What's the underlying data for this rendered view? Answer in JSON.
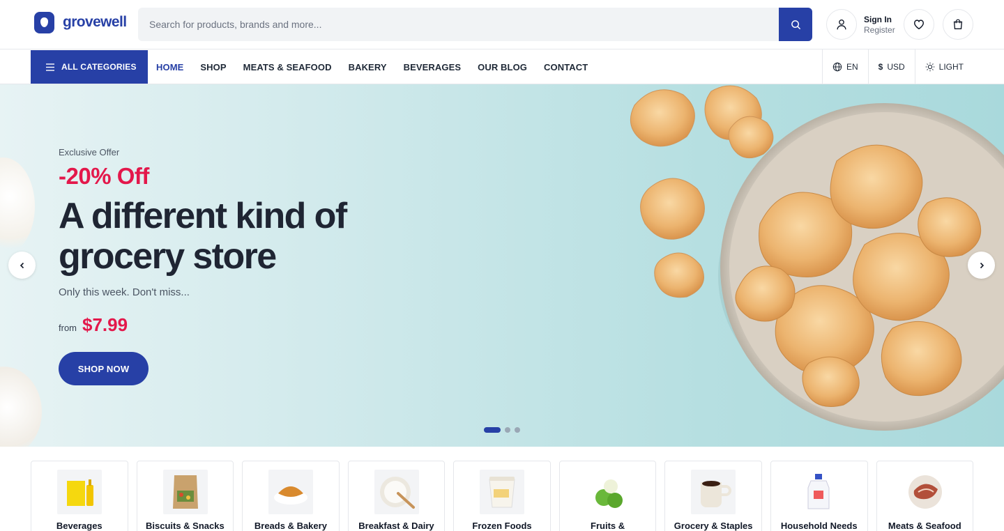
{
  "brand": {
    "name": "grovewell",
    "color": "#2740a6"
  },
  "search": {
    "placeholder": "Search for products, brands and more...",
    "value": ""
  },
  "account": {
    "sign_in": "Sign In",
    "register": "Register"
  },
  "nav": {
    "all_categories": "ALL CATEGORIES",
    "links": [
      "HOME",
      "SHOP",
      "MEATS & SEAFOOD",
      "BAKERY",
      "BEVERAGES",
      "OUR BLOG",
      "CONTACT"
    ],
    "active": "HOME",
    "language": "EN",
    "currency": "USD",
    "currency_symbol": "$",
    "theme": "LIGHT"
  },
  "hero": {
    "eyebrow": "Exclusive Offer",
    "discount": "-20% Off",
    "headline": "A different kind of grocery store",
    "subline": "Only this week. Don't miss...",
    "price_prefix": "from",
    "price": "$7.99",
    "cta": "SHOP NOW",
    "slides": 3,
    "active_slide": 1
  },
  "categories": [
    {
      "label": "Beverages",
      "icon": "juice-bottle-icon"
    },
    {
      "label": "Biscuits & Snacks",
      "icon": "snack-bag-icon"
    },
    {
      "label": "Breads & Bakery",
      "icon": "croissant-icon"
    },
    {
      "label": "Breakfast & Dairy",
      "icon": "yogurt-bowl-icon"
    },
    {
      "label": "Frozen Foods",
      "icon": "ice-cream-tub-icon"
    },
    {
      "label": "Fruits &",
      "icon": "apples-icon"
    },
    {
      "label": "Grocery & Staples",
      "icon": "coffee-mug-icon"
    },
    {
      "label": "Household Needs",
      "icon": "detergent-bottle-icon"
    },
    {
      "label": "Meats & Seafood",
      "icon": "meat-plate-icon"
    }
  ],
  "colors": {
    "accent": "#2740a6",
    "sale": "#e3184b"
  }
}
